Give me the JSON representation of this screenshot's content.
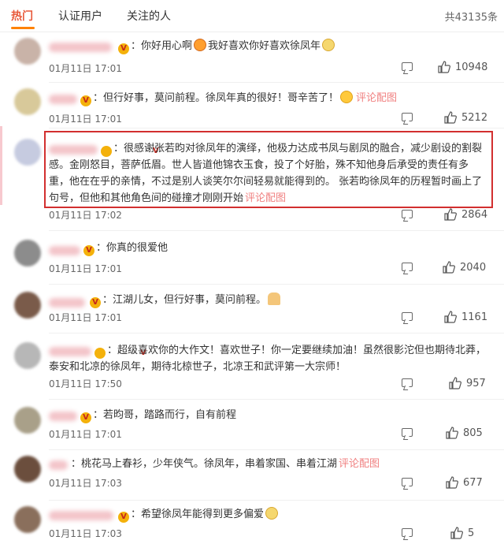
{
  "tabs": {
    "hot": "热门",
    "verified": "认证用户",
    "following": "关注的人",
    "total": "共43135条"
  },
  "link_label": "评论配图",
  "comments": [
    {
      "text": "你好用心啊",
      "text2": "我好喜欢你好喜欢徐凤年",
      "time": "01月11日 17:01",
      "likes": "10948"
    },
    {
      "text": "但行好事，莫问前程。徐凤年真的很好！哥辛苦了！",
      "time": "01月11日 17:01",
      "likes": "5212"
    },
    {
      "text": "很感谢张若昀对徐凤年的演绎，他极力达成书凤与剧凤的融合，减少剧设的割裂感。金刚怒目，菩萨低眉。世人皆道他锦衣玉食，投了个好胎，殊不知他身后承受的责任有多重，他在在乎的亲情，不过是别人谈笑尔尔间轻易就能得到的。 张若昀徐凤年的历程暂时画上了句号，但他和其他角色间的碰撞才刚刚开始",
      "time": "01月11日 17:02",
      "likes": "2864"
    },
    {
      "text": "你真的很爱他",
      "time": "01月11日 17:01",
      "likes": "2040"
    },
    {
      "text": "江湖儿女，但行好事，莫问前程。",
      "time": "01月11日 17:01",
      "likes": "1161"
    },
    {
      "text": "超级喜欢你的大作文！喜欢世子！你一定要继续加油！虽然很影沱但也期待北莽，泰安和北凉的徐凤年，期待北椋世子，北凉王和武评第一大宗师！",
      "time": "01月11日 17:50",
      "likes": "957"
    },
    {
      "text": "若昀哥，踏路而行，自有前程",
      "time": "01月11日 17:01",
      "likes": "805"
    },
    {
      "text": "桃花马上春衫，少年侠气。徐凤年，串着家国、串着江湖",
      "time": "01月11日 17:03",
      "likes": "677"
    },
    {
      "text": "希望徐凤年能得到更多偏爱",
      "time": "01月11日 17:03",
      "likes": "5"
    }
  ],
  "colors": {
    "accent": "#e8593a",
    "tab_underline": "#ff8200",
    "highlight_border": "#d22f2f",
    "link": "#f08080"
  }
}
